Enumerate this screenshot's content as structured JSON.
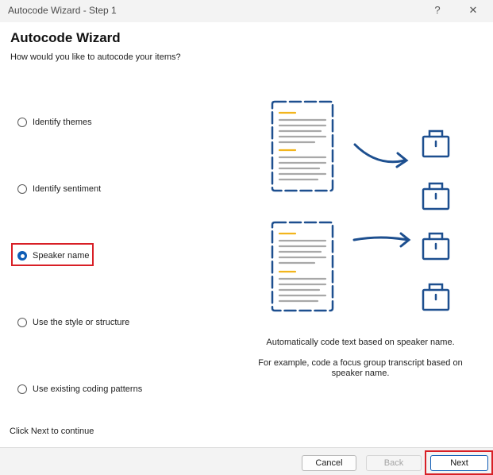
{
  "window": {
    "title": "Autocode Wizard - Step 1",
    "help_glyph": "?",
    "close_glyph": "✕"
  },
  "heading": "Autocode Wizard",
  "subheading": "How would you like to autocode your items?",
  "options": [
    {
      "label": "Identify themes",
      "selected": false
    },
    {
      "label": "Identify sentiment",
      "selected": false
    },
    {
      "label": "Speaker name",
      "selected": true
    },
    {
      "label": "Use the style or structure",
      "selected": false
    },
    {
      "label": "Use existing coding patterns",
      "selected": false
    }
  ],
  "description": {
    "line1": "Automatically code text based on speaker name.",
    "line2": "For example, code a focus group transcript based on speaker name."
  },
  "footer_hint": "Click Next to continue",
  "buttons": {
    "cancel": "Cancel",
    "back": "Back",
    "next": "Next"
  },
  "colors": {
    "accent": "#0f5db6",
    "illustration": "#1d4f8f",
    "highlight_line": "#f2b51d",
    "annotation": "#d81f26"
  },
  "icons": [
    "document-icon",
    "arrow-icon",
    "briefcase-icon"
  ]
}
